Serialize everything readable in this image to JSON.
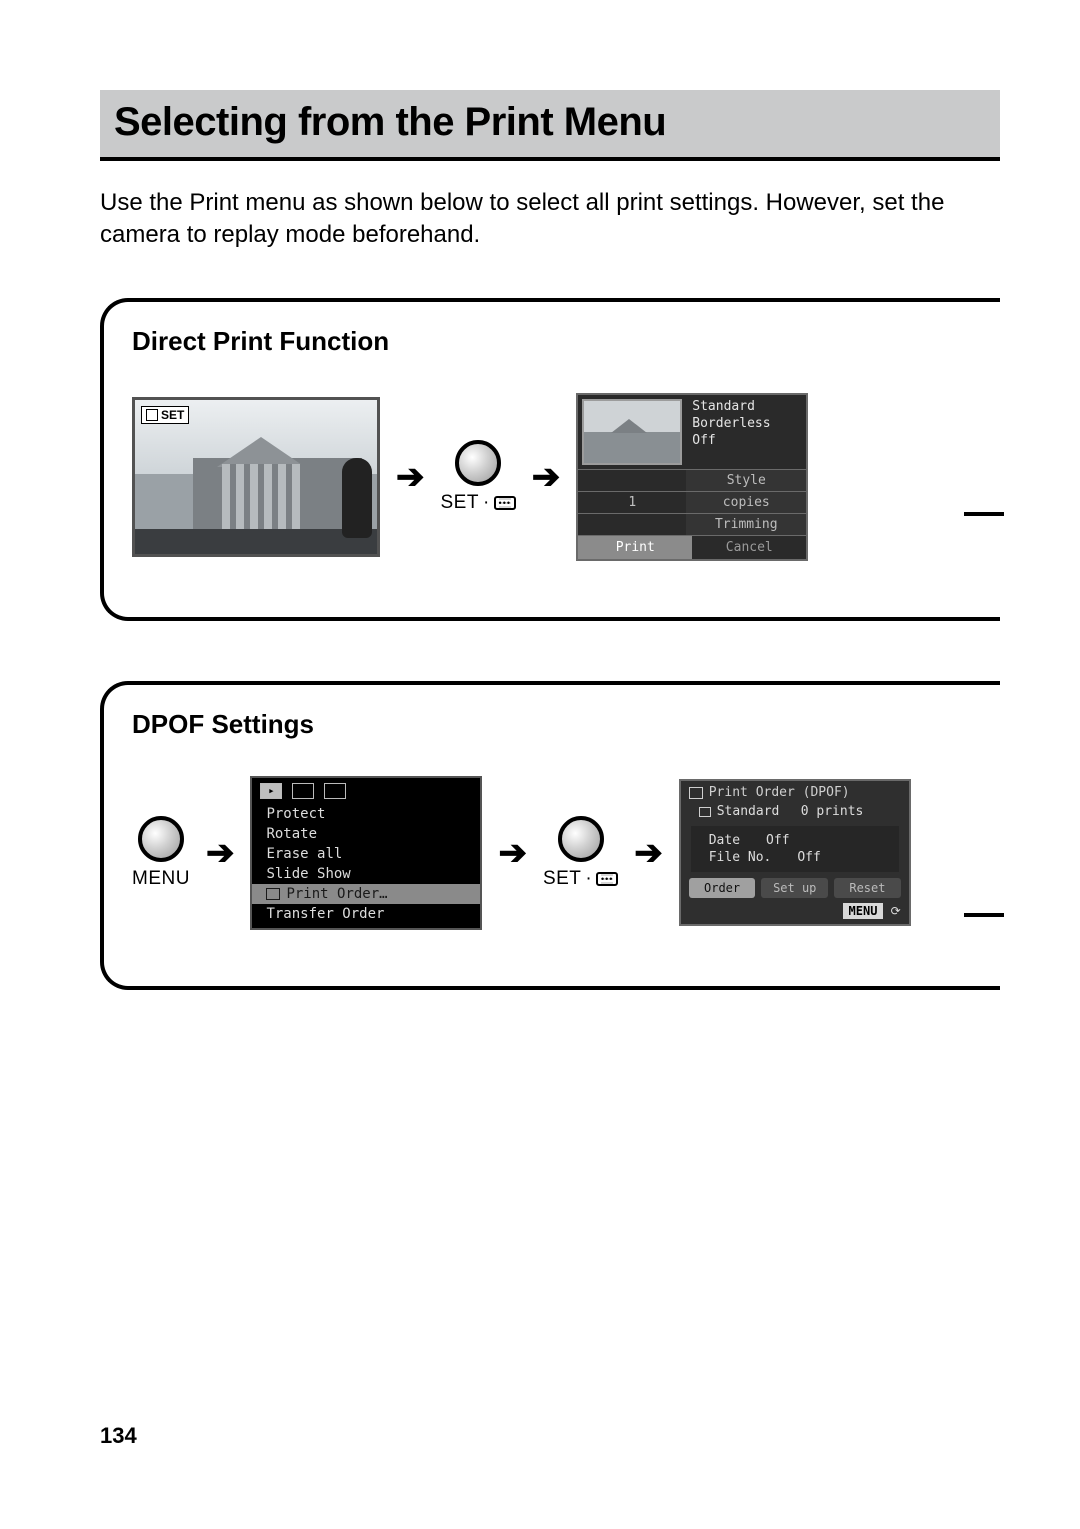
{
  "page_number": "134",
  "title": "Selecting from the Print Menu",
  "intro": "Use the Print menu as shown below to select all print settings. However, set the camera to replay mode beforehand.",
  "labels": {
    "menu": "MENU",
    "set": "SET"
  },
  "panel1": {
    "heading": "Direct Print Function",
    "photo_tag": "SET",
    "lcd": {
      "opt_standard": "Standard",
      "opt_borderless": "Borderless",
      "opt_off": "Off",
      "row_style": "Style",
      "row_copies_val": "1",
      "row_copies": "copies",
      "row_trimming": "Trimming",
      "btn_print": "Print",
      "btn_cancel": "Cancel"
    }
  },
  "panel2": {
    "heading": "DPOF Settings",
    "menu_lcd": {
      "items": {
        "protect": "Protect",
        "rotate": "Rotate",
        "erase": "Erase all",
        "slide": "Slide Show",
        "print_order": "Print Order…",
        "transfer": "Transfer Order"
      }
    },
    "order_lcd": {
      "header": "Print Order (DPOF)",
      "standard": "Standard",
      "prints": "0 prints",
      "date_k": "Date",
      "date_v": "Off",
      "file_k": "File No.",
      "file_v": "Off",
      "btn_order": "Order",
      "btn_setup": "Set up",
      "btn_reset": "Reset",
      "menu_return": "MENU"
    }
  }
}
